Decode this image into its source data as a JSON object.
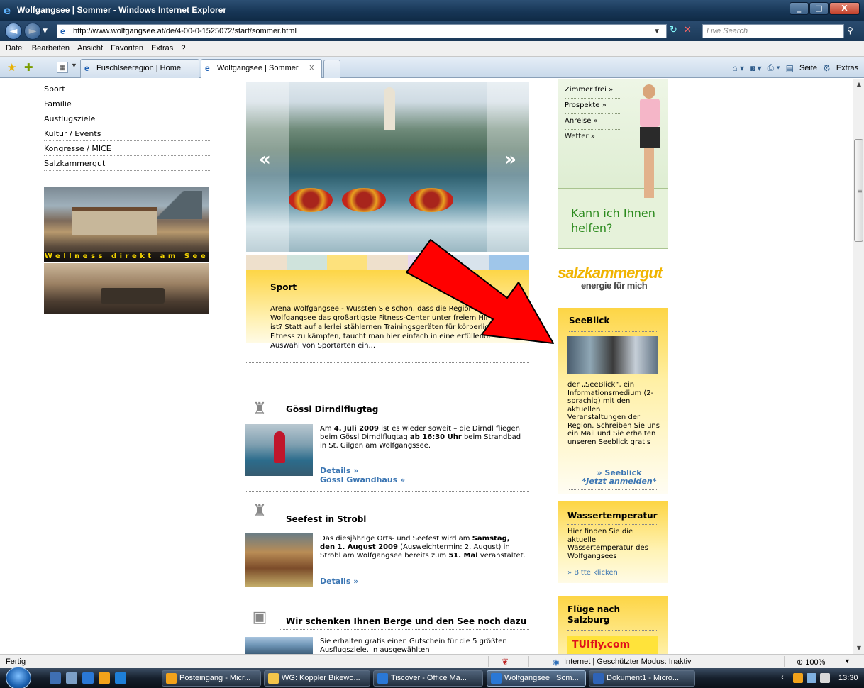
{
  "window": {
    "title": "Wolfgangsee | Sommer - Windows Internet Explorer"
  },
  "address": {
    "url": "http://www.wolfgangsee.at/de/4-00-0-1525072/start/sommer.html",
    "search_placeholder": "Live Search"
  },
  "menu": [
    "Datei",
    "Bearbeiten",
    "Ansicht",
    "Favoriten",
    "Extras",
    "?"
  ],
  "tabs": [
    {
      "label": "Fuschlseeregion | Home"
    },
    {
      "label": "Wolfgangsee | Sommer",
      "close": "X"
    }
  ],
  "commandbar": {
    "page_label": "Seite",
    "tools_label": "Extras"
  },
  "leftnav": {
    "items": [
      "Sport",
      "Familie",
      "Ausflugsziele",
      "Kultur / Events",
      "Kongresse / MICE",
      "Salzkammergut"
    ]
  },
  "hotel_banner": {
    "caption": "Wellness direkt am See"
  },
  "hero": {
    "prev": "«",
    "next": "»"
  },
  "colorstrip": [
    "#eee0cc",
    "#cfe3dc",
    "#fde17c",
    "#eee0cc",
    "#e8d6ef",
    "#d8e3ec",
    "#9fc6ea"
  ],
  "sport": {
    "title": "Sport",
    "text": "Arena Wolfgangsee - Wussten Sie schon, dass die Region Wolfgangsee das großartigste Fitness-Center unter freiem Himmel ist? Statt auf allerlei stählernen Trainingsgeräten für körperliche Fitness zu kämpfen, taucht man hier einfach in eine erfüllende Auswahl von Sportarten ein..."
  },
  "events": [
    {
      "title": "Gössl Dirndlflugtag",
      "t1": "Am ",
      "b1": "4. Juli 2009",
      "t2": " ist es wieder soweit – die Dirndl fliegen beim Gössl Dirndlflugtag ",
      "b2": "ab 16:30 Uhr",
      "t3": " beim Strandbad in St. Gilgen am Wolfgangssee.",
      "links": [
        "Details »",
        "Gössl Gwandhaus »"
      ]
    },
    {
      "title": "Seefest in Strobl",
      "t1": "Das diesjährige Orts- und Seefest wird am ",
      "b1": "Samstag, den 1. August 2009",
      "t2": " (Ausweichtermin: 2. August) in Strobl am Wolfgangsee bereits zum ",
      "b2": "51. Mal",
      "t3": " veranstaltet.",
      "links": [
        "Details »"
      ]
    },
    {
      "title": "Wir schenken Ihnen Berge und den See noch dazu",
      "t1": "Sie erhalten gratis einen Gutschein für die 5 größten Ausflugsziele. In ausgewählten",
      "links": []
    }
  ],
  "help": {
    "links": [
      "Zimmer frei »",
      "Prospekte »",
      "Anreise »",
      "Wetter »"
    ],
    "bubble": "Kann ich Ihnen helfen?"
  },
  "brand": {
    "line1": "salzkammergut",
    "line2": "energie für mich"
  },
  "seeblick": {
    "title": "SeeBlick",
    "text": "der „SeeBlick“, ein Informationsmedium (2-sprachig) mit den aktuellen Veranstaltungen der Region. Schreiben Sie uns ein Mail und Sie erhalten unseren Seeblick gratis",
    "cta1": "» Seeblick",
    "cta2": "*Jetzt anmelden*"
  },
  "wasser": {
    "title": "Wassertemperatur",
    "text": "Hier finden Sie die aktuelle Wassertemperatur des Wolfgangsees",
    "link": "» Bitte klicken"
  },
  "fluege": {
    "title": "Flüge nach Salzburg",
    "logo": "TUIfly.com"
  },
  "status": {
    "text": "Fertig",
    "zone": "Internet | Geschützter Modus: Inaktiv",
    "zoom": "100%"
  },
  "taskbar": {
    "tasks": [
      "Posteingang - Micr...",
      "WG: Koppler Bikewo...",
      "Tiscover - Office Ma...",
      "Wolfgangsee | Som...",
      "Dokument1 - Micro..."
    ],
    "clock": "13:30"
  }
}
